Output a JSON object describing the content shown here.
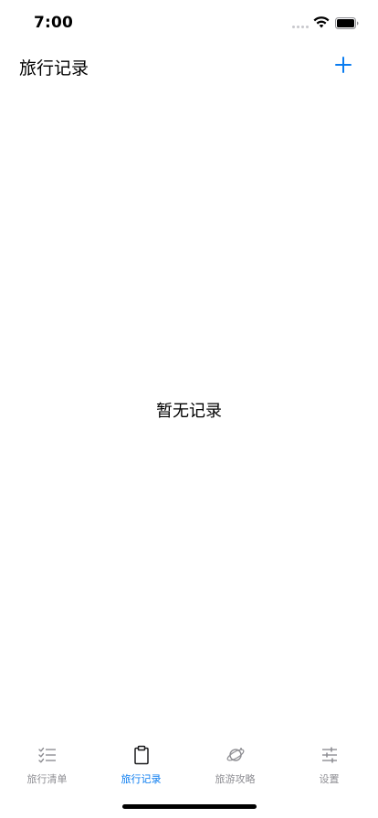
{
  "status_bar": {
    "time": "7:00"
  },
  "nav": {
    "title": "旅行记录",
    "add_icon": "plus-icon"
  },
  "main": {
    "empty_message": "暂无记录"
  },
  "tab_bar": {
    "tabs": [
      {
        "label": "旅行清单",
        "icon": "checklist-icon",
        "active": false
      },
      {
        "label": "旅行记录",
        "icon": "clipboard-icon",
        "active": true
      },
      {
        "label": "旅游攻略",
        "icon": "planet-icon",
        "active": false
      },
      {
        "label": "设置",
        "icon": "sliders-icon",
        "active": false
      }
    ]
  },
  "colors": {
    "accent": "#0a7cf0",
    "inactive": "#8e8e93",
    "background": "#ffffff",
    "text": "#000000"
  }
}
